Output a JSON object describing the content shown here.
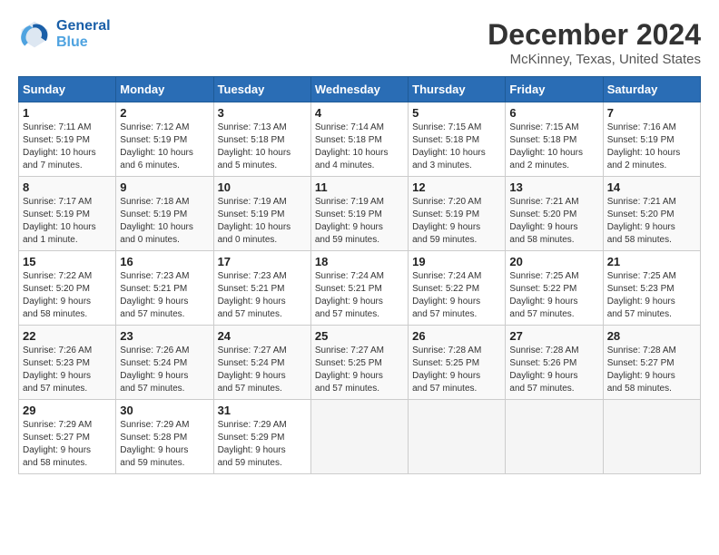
{
  "header": {
    "logo_line1": "General",
    "logo_line2": "Blue",
    "title": "December 2024",
    "subtitle": "McKinney, Texas, United States"
  },
  "weekdays": [
    "Sunday",
    "Monday",
    "Tuesday",
    "Wednesday",
    "Thursday",
    "Friday",
    "Saturday"
  ],
  "weeks": [
    [
      {
        "day": "1",
        "info": "Sunrise: 7:11 AM\nSunset: 5:19 PM\nDaylight: 10 hours\nand 7 minutes."
      },
      {
        "day": "2",
        "info": "Sunrise: 7:12 AM\nSunset: 5:19 PM\nDaylight: 10 hours\nand 6 minutes."
      },
      {
        "day": "3",
        "info": "Sunrise: 7:13 AM\nSunset: 5:18 PM\nDaylight: 10 hours\nand 5 minutes."
      },
      {
        "day": "4",
        "info": "Sunrise: 7:14 AM\nSunset: 5:18 PM\nDaylight: 10 hours\nand 4 minutes."
      },
      {
        "day": "5",
        "info": "Sunrise: 7:15 AM\nSunset: 5:18 PM\nDaylight: 10 hours\nand 3 minutes."
      },
      {
        "day": "6",
        "info": "Sunrise: 7:15 AM\nSunset: 5:18 PM\nDaylight: 10 hours\nand 2 minutes."
      },
      {
        "day": "7",
        "info": "Sunrise: 7:16 AM\nSunset: 5:19 PM\nDaylight: 10 hours\nand 2 minutes."
      }
    ],
    [
      {
        "day": "8",
        "info": "Sunrise: 7:17 AM\nSunset: 5:19 PM\nDaylight: 10 hours\nand 1 minute."
      },
      {
        "day": "9",
        "info": "Sunrise: 7:18 AM\nSunset: 5:19 PM\nDaylight: 10 hours\nand 0 minutes."
      },
      {
        "day": "10",
        "info": "Sunrise: 7:19 AM\nSunset: 5:19 PM\nDaylight: 10 hours\nand 0 minutes."
      },
      {
        "day": "11",
        "info": "Sunrise: 7:19 AM\nSunset: 5:19 PM\nDaylight: 9 hours\nand 59 minutes."
      },
      {
        "day": "12",
        "info": "Sunrise: 7:20 AM\nSunset: 5:19 PM\nDaylight: 9 hours\nand 59 minutes."
      },
      {
        "day": "13",
        "info": "Sunrise: 7:21 AM\nSunset: 5:20 PM\nDaylight: 9 hours\nand 58 minutes."
      },
      {
        "day": "14",
        "info": "Sunrise: 7:21 AM\nSunset: 5:20 PM\nDaylight: 9 hours\nand 58 minutes."
      }
    ],
    [
      {
        "day": "15",
        "info": "Sunrise: 7:22 AM\nSunset: 5:20 PM\nDaylight: 9 hours\nand 58 minutes."
      },
      {
        "day": "16",
        "info": "Sunrise: 7:23 AM\nSunset: 5:21 PM\nDaylight: 9 hours\nand 57 minutes."
      },
      {
        "day": "17",
        "info": "Sunrise: 7:23 AM\nSunset: 5:21 PM\nDaylight: 9 hours\nand 57 minutes."
      },
      {
        "day": "18",
        "info": "Sunrise: 7:24 AM\nSunset: 5:21 PM\nDaylight: 9 hours\nand 57 minutes."
      },
      {
        "day": "19",
        "info": "Sunrise: 7:24 AM\nSunset: 5:22 PM\nDaylight: 9 hours\nand 57 minutes."
      },
      {
        "day": "20",
        "info": "Sunrise: 7:25 AM\nSunset: 5:22 PM\nDaylight: 9 hours\nand 57 minutes."
      },
      {
        "day": "21",
        "info": "Sunrise: 7:25 AM\nSunset: 5:23 PM\nDaylight: 9 hours\nand 57 minutes."
      }
    ],
    [
      {
        "day": "22",
        "info": "Sunrise: 7:26 AM\nSunset: 5:23 PM\nDaylight: 9 hours\nand 57 minutes."
      },
      {
        "day": "23",
        "info": "Sunrise: 7:26 AM\nSunset: 5:24 PM\nDaylight: 9 hours\nand 57 minutes."
      },
      {
        "day": "24",
        "info": "Sunrise: 7:27 AM\nSunset: 5:24 PM\nDaylight: 9 hours\nand 57 minutes."
      },
      {
        "day": "25",
        "info": "Sunrise: 7:27 AM\nSunset: 5:25 PM\nDaylight: 9 hours\nand 57 minutes."
      },
      {
        "day": "26",
        "info": "Sunrise: 7:28 AM\nSunset: 5:25 PM\nDaylight: 9 hours\nand 57 minutes."
      },
      {
        "day": "27",
        "info": "Sunrise: 7:28 AM\nSunset: 5:26 PM\nDaylight: 9 hours\nand 57 minutes."
      },
      {
        "day": "28",
        "info": "Sunrise: 7:28 AM\nSunset: 5:27 PM\nDaylight: 9 hours\nand 58 minutes."
      }
    ],
    [
      {
        "day": "29",
        "info": "Sunrise: 7:29 AM\nSunset: 5:27 PM\nDaylight: 9 hours\nand 58 minutes."
      },
      {
        "day": "30",
        "info": "Sunrise: 7:29 AM\nSunset: 5:28 PM\nDaylight: 9 hours\nand 59 minutes."
      },
      {
        "day": "31",
        "info": "Sunrise: 7:29 AM\nSunset: 5:29 PM\nDaylight: 9 hours\nand 59 minutes."
      },
      null,
      null,
      null,
      null
    ]
  ]
}
